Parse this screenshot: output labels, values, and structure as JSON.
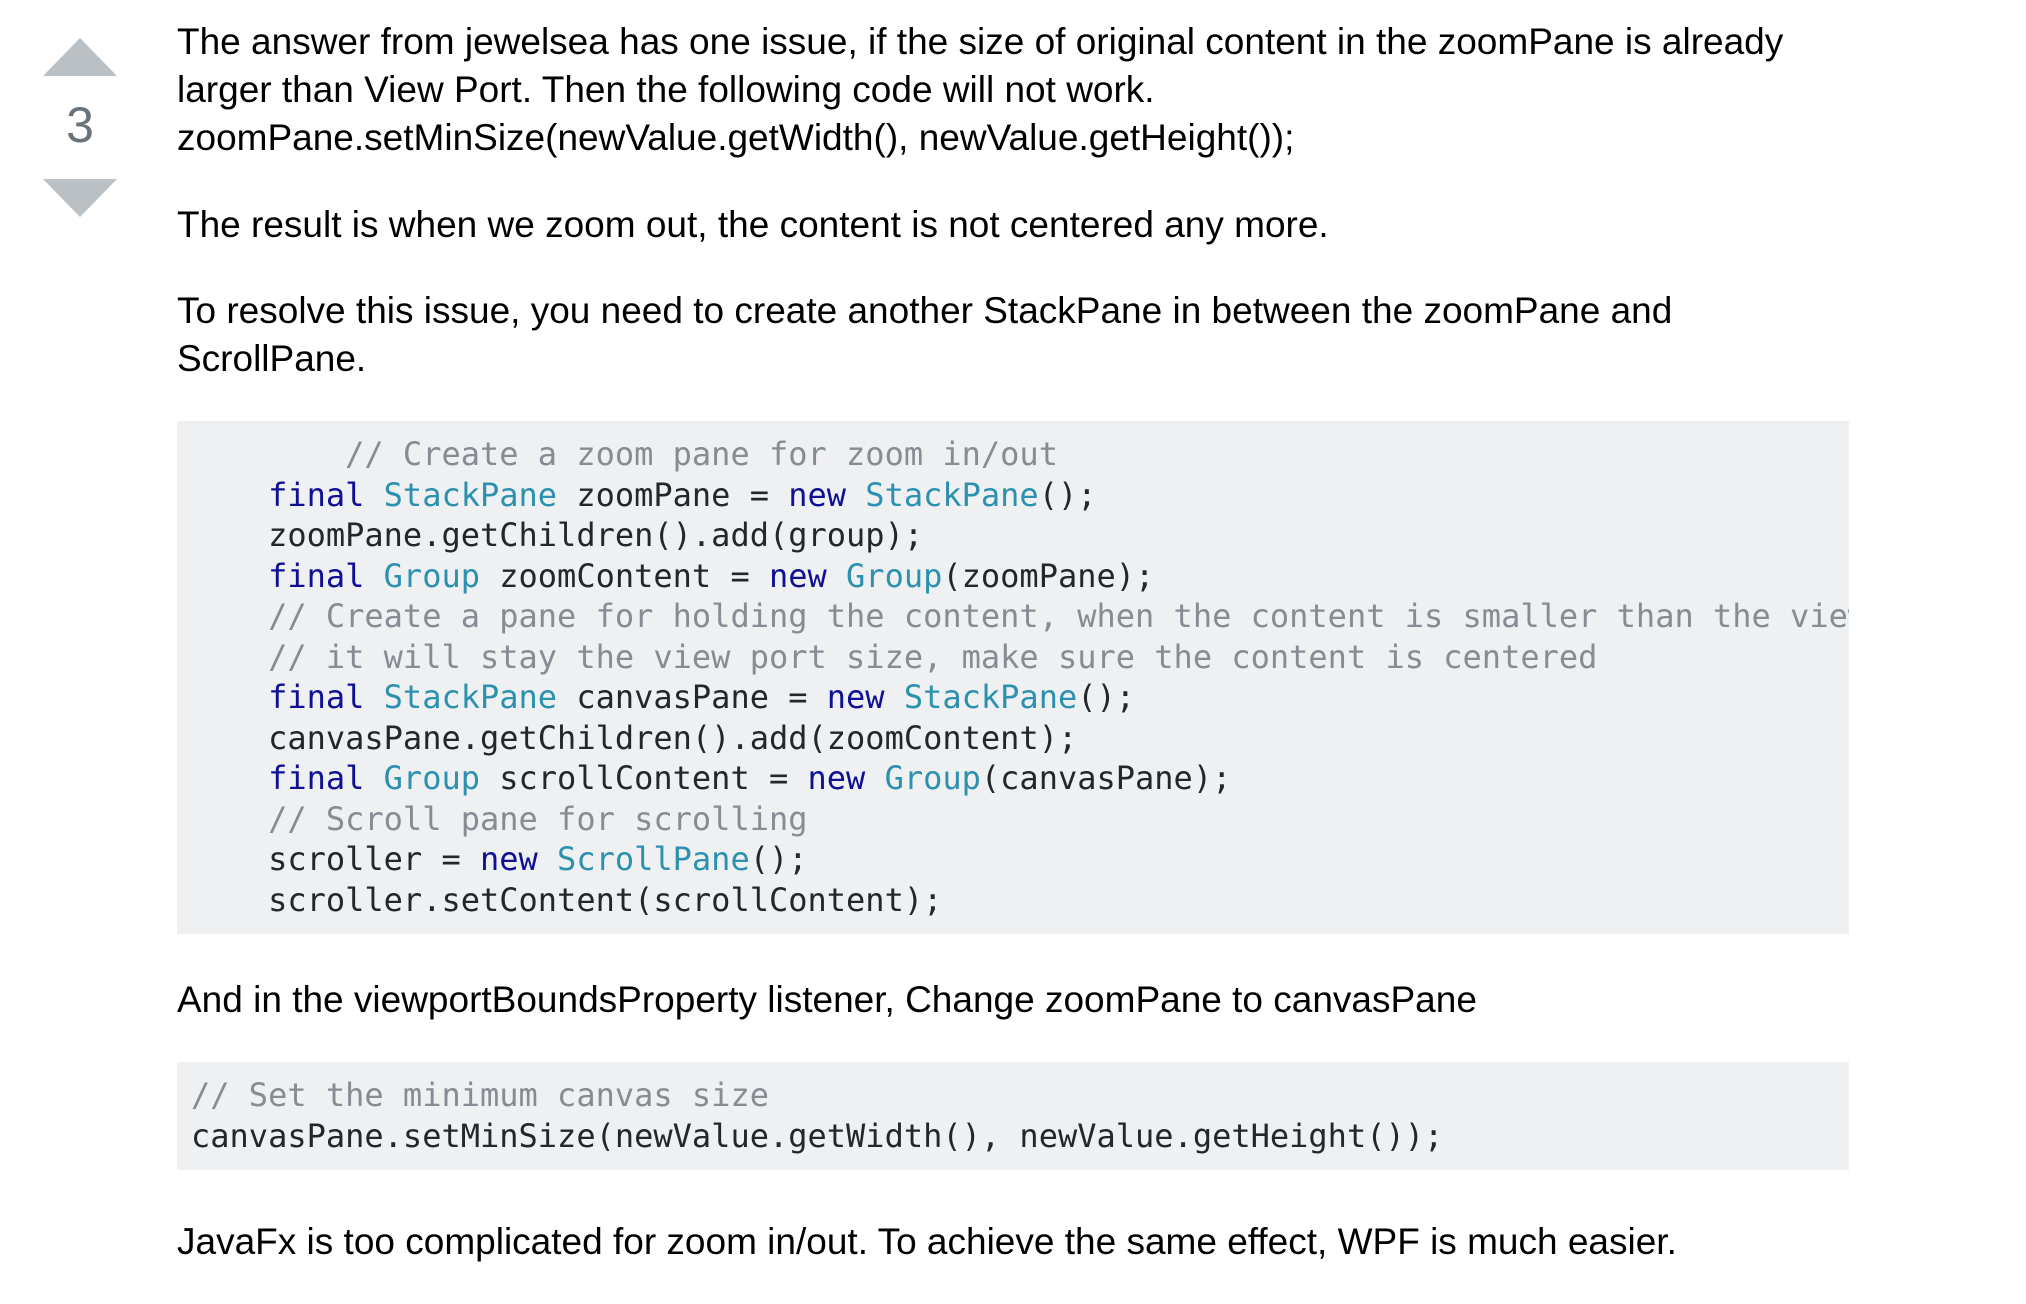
{
  "vote": {
    "count": "3"
  },
  "answer": {
    "para1_line1": "The answer from jewelsea has one issue, if the size of original content in the zoomPane is already",
    "para1_line2": "larger than View Port. Then the following code will not work.",
    "para1_line3": "zoomPane.setMinSize(newValue.getWidth(), newValue.getHeight());",
    "para2": "The result is when we zoom out, the content is not centered any more.",
    "para3_line1": "To resolve this issue, you need to create another StackPane in between the zoomPane and",
    "para3_line2": "ScrollPane.",
    "para4": "And in the viewportBoundsProperty listener, Change zoomPane to canvasPane",
    "para5": "JavaFx is too complicated for zoom in/out. To achieve the same effect, WPF is much easier."
  },
  "code_block_1": {
    "l1_comment": "        // Create a zoom pane for zoom in/out",
    "l2_indent": "    ",
    "l2_kw": "final",
    "l2_type": "StackPane",
    "l2_mid": " zoomPane = ",
    "l2_kw2": "new",
    "l2_type2": "StackPane",
    "l2_end": "();",
    "l3": "    zoomPane.getChildren().add(group);",
    "l4_indent": "    ",
    "l4_kw": "final",
    "l4_type": "Group",
    "l4_mid": " zoomContent = ",
    "l4_kw2": "new",
    "l4_type2": "Group",
    "l4_end": "(zoomPane);",
    "l5_comment": "    // Create a pane for holding the content, when the content is smaller than the view port,",
    "l6_comment": "    // it will stay the view port size, make sure the content is centered",
    "l7_indent": "    ",
    "l7_kw": "final",
    "l7_type": "StackPane",
    "l7_mid": " canvasPane = ",
    "l7_kw2": "new",
    "l7_type2": "StackPane",
    "l7_end": "();",
    "l8": "    canvasPane.getChildren().add(zoomContent);",
    "l9_indent": "    ",
    "l9_kw": "final",
    "l9_type": "Group",
    "l9_mid": " scrollContent = ",
    "l9_kw2": "new",
    "l9_type2": "Group",
    "l9_end": "(canvasPane);",
    "l10_comment": "    // Scroll pane for scrolling",
    "l11_start": "    scroller = ",
    "l11_kw": "new",
    "l11_type": "ScrollPane",
    "l11_end": "();",
    "l12": "    scroller.setContent(scrollContent);"
  },
  "code_block_2": {
    "l1_comment": "// Set the minimum canvas size",
    "l2": "canvasPane.setMinSize(newValue.getWidth(), newValue.getHeight());"
  }
}
